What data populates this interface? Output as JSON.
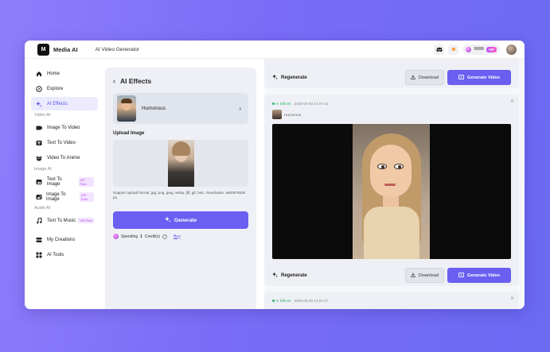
{
  "app": {
    "logo_glyph": "M",
    "logo_text": "Media AI",
    "page_title": "AI Video Generator",
    "credits": "9999",
    "vip_badge": "VIP"
  },
  "sidebar": {
    "items": [
      {
        "label": "Home",
        "icon": "home-icon"
      },
      {
        "label": "Explore",
        "icon": "explore-icon"
      },
      {
        "label": "AI Effects",
        "icon": "sparkle-icon",
        "active": true
      }
    ],
    "sections": [
      {
        "title": "Video AI",
        "items": [
          {
            "label": "Image To Video"
          },
          {
            "label": "Text To Video"
          },
          {
            "label": "Video To Anime"
          }
        ]
      },
      {
        "title": "Image AI",
        "items": [
          {
            "label": "Text To Image",
            "badge": "VIP Free"
          },
          {
            "label": "Image To Image",
            "badge": "VIP Free"
          }
        ]
      },
      {
        "title": "Audio AI",
        "items": [
          {
            "label": "Text To Music",
            "badge": "VIP Free"
          }
        ]
      }
    ],
    "bottom_items": [
      {
        "label": "My Creations"
      },
      {
        "label": "AI Tools"
      }
    ]
  },
  "effects_panel": {
    "back_glyph": "‹",
    "title": "AI Effects",
    "effect_name": "Humorous",
    "arrow_glyph": "›",
    "upload_label": "Upload Image",
    "upload_hint": "Support upload format: jpg, png, jpeg, webp, jfif, gif, heic. Resolution: ≤6000*6000 px.",
    "generate_label": "Generate",
    "spend_prefix": "Spending",
    "spend_amount": "1",
    "spend_suffix": "Credit(s)",
    "buy_label": "Buy"
  },
  "results": {
    "card1": {
      "regenerate_label": "Regenerate",
      "download_label": "Download",
      "generate_video_label": "Generate Video"
    },
    "card2": {
      "tag": "AI Effects",
      "timestamp": "2025-06-03 14:07:42",
      "effect": "Humorous",
      "regenerate_label": "Regenerate",
      "download_label": "Download",
      "generate_video_label": "Generate Video"
    },
    "card3": {
      "tag": "AI Effects",
      "timestamp": "2025-06-03 14:01:17"
    }
  },
  "colors": {
    "accent": "#6a5ff1",
    "success": "#34b36b",
    "background_gradient_start": "#8f7dfb",
    "background_gradient_end": "#6a6af3"
  }
}
